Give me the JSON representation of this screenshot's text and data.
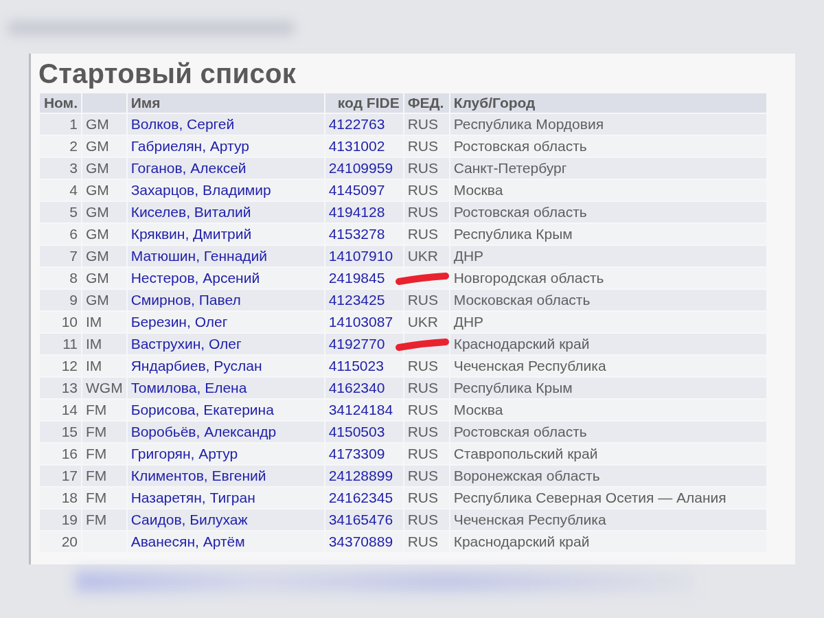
{
  "title": "Стартовый список",
  "table": {
    "columns": [
      "Ном.",
      "",
      "Имя",
      "код FIDE",
      "ФЕД.",
      "Клуб/Город"
    ],
    "rows": [
      {
        "no": "1",
        "title": "GM",
        "name": "Волков, Сергей",
        "fide": "4122763",
        "fed": "RUS",
        "club": "Республика Мордовия",
        "crossed_out": false
      },
      {
        "no": "2",
        "title": "GM",
        "name": "Габриелян, Артур",
        "fide": "4131002",
        "fed": "RUS",
        "club": "Ростовская область",
        "crossed_out": false
      },
      {
        "no": "3",
        "title": "GM",
        "name": "Гоганов, Алексей",
        "fide": "24109959",
        "fed": "RUS",
        "club": "Санкт-Петербург",
        "crossed_out": false
      },
      {
        "no": "4",
        "title": "GM",
        "name": "Захарцов, Владимир",
        "fide": "4145097",
        "fed": "RUS",
        "club": "Москва",
        "crossed_out": false
      },
      {
        "no": "5",
        "title": "GM",
        "name": "Киселев, Виталий",
        "fide": "4194128",
        "fed": "RUS",
        "club": "Ростовская область",
        "crossed_out": false
      },
      {
        "no": "6",
        "title": "GM",
        "name": "Кряквин, Дмитрий",
        "fide": "4153278",
        "fed": "RUS",
        "club": "Республика Крым",
        "crossed_out": false
      },
      {
        "no": "7",
        "title": "GM",
        "name": "Матюшин, Геннадий",
        "fide": "14107910",
        "fed": "UKR",
        "club": "ДНР",
        "crossed_out": false
      },
      {
        "no": "8",
        "title": "GM",
        "name": "Нестеров, Арсений",
        "fide": "2419845",
        "club": "Новгородская область",
        "crossed_out": true
      },
      {
        "no": "9",
        "title": "GM",
        "name": "Смирнов, Павел",
        "fide": "4123425",
        "fed": "RUS",
        "club": "Московская область",
        "crossed_out": false
      },
      {
        "no": "10",
        "title": "IM",
        "name": "Березин, Олег",
        "fide": "14103087",
        "fed": "UKR",
        "club": "ДНР",
        "crossed_out": false
      },
      {
        "no": "11",
        "title": "IM",
        "name": "Ваструхин, Олег",
        "fide": "4192770",
        "club": "Краснодарский край",
        "crossed_out": true
      },
      {
        "no": "12",
        "title": "IM",
        "name": "Яндарбиев, Руслан",
        "fide": "4115023",
        "fed": "RUS",
        "club": "Чеченская Республика",
        "crossed_out": false
      },
      {
        "no": "13",
        "title": "WGM",
        "name": "Томилова, Елена",
        "fide": "4162340",
        "fed": "RUS",
        "club": "Республика Крым",
        "crossed_out": false
      },
      {
        "no": "14",
        "title": "FM",
        "name": "Борисова, Екатерина",
        "fide": "34124184",
        "fed": "RUS",
        "club": "Москва",
        "crossed_out": false
      },
      {
        "no": "15",
        "title": "FM",
        "name": "Воробьёв, Александр",
        "fide": "4150503",
        "fed": "RUS",
        "club": "Ростовская область",
        "crossed_out": false
      },
      {
        "no": "16",
        "title": "FM",
        "name": "Григорян, Артур",
        "fide": "4173309",
        "fed": "RUS",
        "club": "Ставропольский край",
        "crossed_out": false
      },
      {
        "no": "17",
        "title": "FM",
        "name": "Климентов, Евгений",
        "fide": "24128899",
        "fed": "RUS",
        "club": "Воронежская область",
        "crossed_out": false
      },
      {
        "no": "18",
        "title": "FM",
        "name": "Назаретян, Тигран",
        "fide": "24162345",
        "fed": "RUS",
        "club": "Республика Северная Осетия — Алания",
        "crossed_out": false
      },
      {
        "no": "19",
        "title": "FM",
        "name": "Саидов, Билухаж",
        "fide": "34165476",
        "fed": "RUS",
        "club": "Чеченская Республика",
        "crossed_out": false
      },
      {
        "no": "20",
        "name": "Аванесян, Артём",
        "fide": "34370889",
        "fed": "RUS",
        "club": "Краснодарский край",
        "crossed_out": false
      }
    ]
  }
}
